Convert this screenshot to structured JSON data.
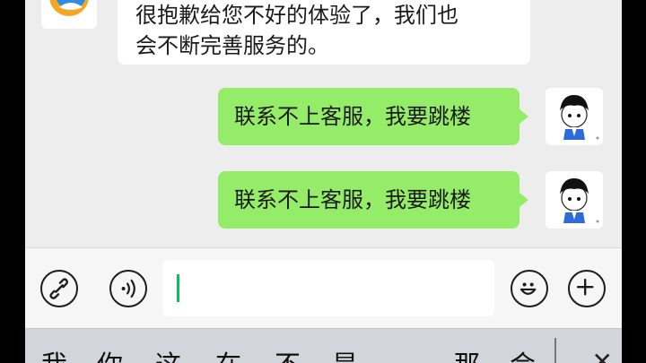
{
  "conversation": {
    "messages": [
      {
        "sender": "service",
        "lines": [
          "很抱歉给您不好的体验了，我们也",
          "会不断完善服务的。"
        ]
      },
      {
        "sender": "me",
        "text": "联系不上客服，我要跳楼"
      },
      {
        "sender": "me",
        "text": "联系不上客服，我要跳楼"
      }
    ]
  },
  "input": {
    "value": ""
  },
  "toolbar": {
    "left_icons": [
      "link-icon",
      "voice-icon"
    ],
    "right_icons": [
      "emoji-icon",
      "plus-icon"
    ]
  },
  "keyboard": {
    "candidates": [
      "我",
      "你",
      "这",
      "在",
      "不",
      "是",
      "那",
      "会"
    ],
    "close_glyph": "✕"
  },
  "colors": {
    "my_bubble": "#95ec69",
    "their_bubble": "#ffffff",
    "caret": "#07c160",
    "background": "#ededed"
  }
}
